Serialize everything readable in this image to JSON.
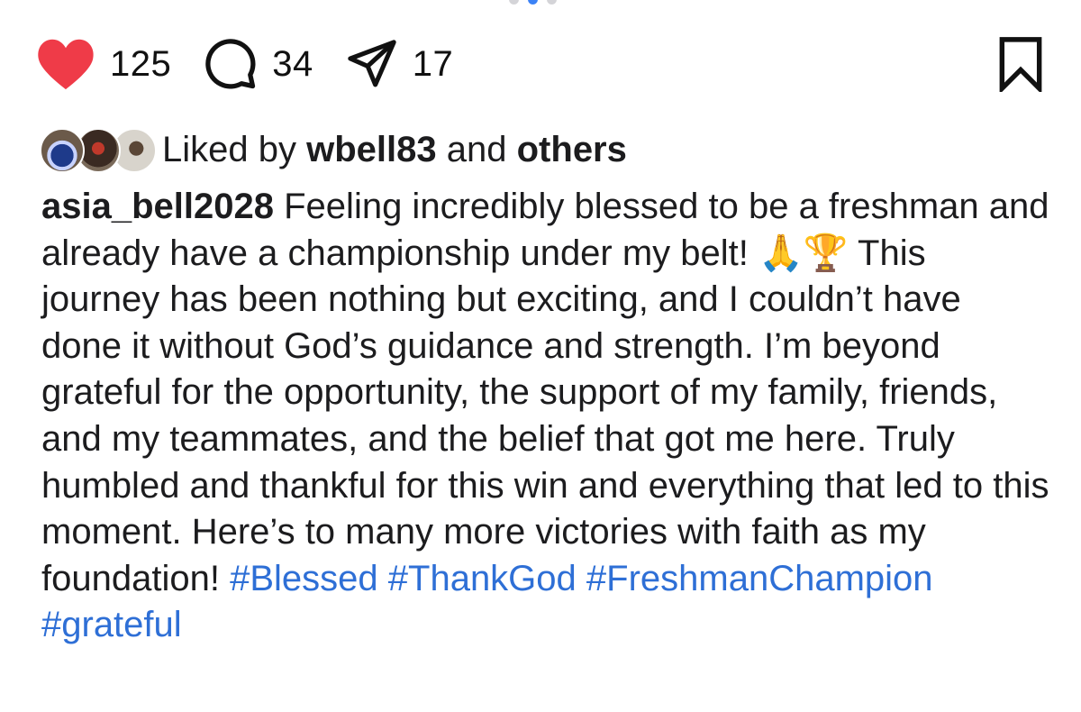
{
  "actions": {
    "likes": "125",
    "comments": "34",
    "shares": "17"
  },
  "liked_by": {
    "prefix": "Liked by",
    "user": "wbell83",
    "and": "and",
    "others": "others"
  },
  "caption": {
    "username": "asia_bell2028",
    "text_part1": "Feeling incredibly blessed to be a freshman and already have a championship under my belt!",
    "emoji1": "🙏",
    "emoji2": "🏆",
    "text_part2": "This journey has been nothing but exciting, and I couldn’t have done it without God’s guidance and strength. I’m beyond grateful for the opportunity, the support of my family, friends, and my teammates, and the belief that got me here. Truly humbled and thankful for this win and everything that led to this moment. Here’s to many more victories with faith as my foundation!",
    "hashtags": [
      "#Blessed",
      "#ThankGod",
      "#FreshmanChampion",
      "#grateful"
    ]
  },
  "colors": {
    "heart": "#ef3b48",
    "hashtag": "#2e6fd6",
    "text": "#1c1c1e"
  },
  "icons": {
    "like": "heart-icon",
    "comment": "comment-bubble-icon",
    "share": "paper-plane-icon",
    "save": "bookmark-icon"
  }
}
